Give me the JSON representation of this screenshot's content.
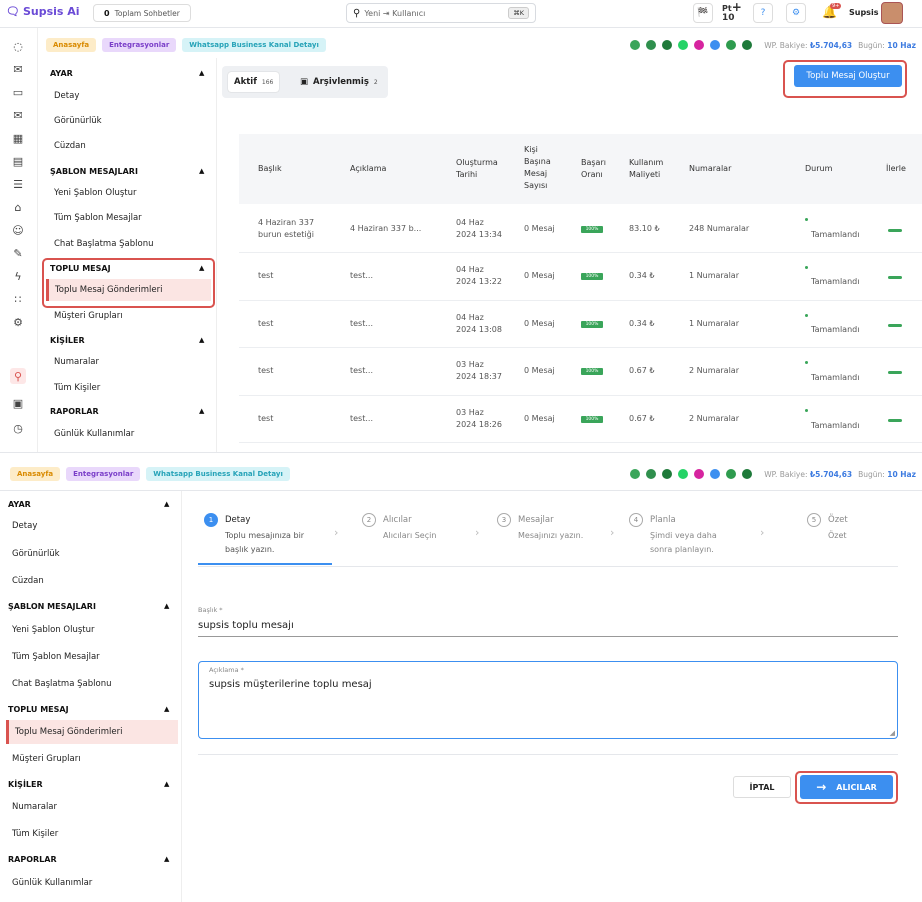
{
  "topbar": {
    "logo": "Supsis Ai",
    "chat_count": "0",
    "chat_count_label": "Toplam Sohbetler",
    "search_placeholder": "Yeni ⇥ Kullanıcı",
    "search_shortcut": "⌘K",
    "pt_label": "Pt",
    "pt_value": "10",
    "notification_badge": "9+",
    "username": "Supsis"
  },
  "breadcrumbs": [
    "Anasayfa",
    "Entegrasyonlar",
    "Whatsapp Business Kanal Detayı"
  ],
  "balance_label": "WP. Bakiye:",
  "balance_value": "₺5.704,63",
  "today_label": "Bugün:",
  "today_value": "10 Haz",
  "menu": {
    "ayar": "AYAR",
    "detay": "Detay",
    "gorunurluk": "Görünürlük",
    "cuzdan": "Cüzdan",
    "sablon": "ŞABLON MESAJLARI",
    "yeni_sablon": "Yeni Şablon Oluştur",
    "tum_sablon": "Tüm Şablon Mesajlar",
    "chat_baslatma": "Chat Başlatma Şablonu",
    "toplu": "TOPLU MESAJ",
    "toplu_gonderim": "Toplu Mesaj Gönderimleri",
    "musteri": "Müşteri Grupları",
    "kisiler": "KİŞİLER",
    "numaralar": "Numaralar",
    "tum_kisiler": "Tüm Kişiler",
    "raporlar": "RAPORLAR",
    "gunluk": "Günlük Kullanımlar"
  },
  "tabs": {
    "active_label": "Aktif",
    "active_count": "166",
    "archived_label": "Arşivlenmiş",
    "archived_count": "2"
  },
  "create_button": "Toplu Mesaj Oluştur",
  "table": {
    "headers": {
      "baslik": "Başlık",
      "aciklama": "Açıklama",
      "tarih_1": "Oluşturma",
      "tarih_2": "Tarihi",
      "kisi_1": "Kişi",
      "kisi_2": "Başına",
      "kisi_3": "Mesaj",
      "kisi_4": "Sayısı",
      "basari_1": "Başarı",
      "basari_2": "Oranı",
      "maliyet_1": "Kullanım",
      "maliyet_2": "Maliyeti",
      "numaralar": "Numaralar",
      "durum": "Durum",
      "ilerleme": "İlerle"
    },
    "rows": [
      {
        "title_1": "4 Haziran 337",
        "title_2": "burun estetiği",
        "desc": "4 Haziran 337 b...",
        "date_1": "04 Haz",
        "date_2": "2024 13:34",
        "msg": "0 Mesaj",
        "rate": "100%",
        "cost": "83.10 ₺",
        "numbers": "248 Numaralar",
        "status": "Tamamlandı"
      },
      {
        "title_1": "test",
        "title_2": "",
        "desc": "test...",
        "date_1": "04 Haz",
        "date_2": "2024 13:22",
        "msg": "0 Mesaj",
        "rate": "100%",
        "cost": "0.34 ₺",
        "numbers": "1 Numaralar",
        "status": "Tamamlandı"
      },
      {
        "title_1": "test",
        "title_2": "",
        "desc": "test...",
        "date_1": "04 Haz",
        "date_2": "2024 13:08",
        "msg": "0 Mesaj",
        "rate": "100%",
        "cost": "0.34 ₺",
        "numbers": "1 Numaralar",
        "status": "Tamamlandı"
      },
      {
        "title_1": "test",
        "title_2": "",
        "desc": "test...",
        "date_1": "03 Haz",
        "date_2": "2024 18:37",
        "msg": "0 Mesaj",
        "rate": "100%",
        "cost": "0.67 ₺",
        "numbers": "2 Numaralar",
        "status": "Tamamlandı"
      },
      {
        "title_1": "test",
        "title_2": "",
        "desc": "test...",
        "date_1": "03 Haz",
        "date_2": "2024 18:26",
        "msg": "0 Mesaj",
        "rate": "100%",
        "cost": "0.67 ₺",
        "numbers": "2 Numaralar",
        "status": "Tamamlandı"
      }
    ]
  },
  "wizard": {
    "steps": [
      {
        "num": "1",
        "title": "Detay",
        "sub_1": "Toplu mesajınıza bir",
        "sub_2": "başlık yazın."
      },
      {
        "num": "2",
        "title": "Alıcılar",
        "sub_1": "Alıcıları Seçin",
        "sub_2": ""
      },
      {
        "num": "3",
        "title": "Mesajlar",
        "sub_1": "Mesajınızı yazın.",
        "sub_2": ""
      },
      {
        "num": "4",
        "title": "Planla",
        "sub_1": "Şimdi veya daha",
        "sub_2": "sonra planlayın."
      },
      {
        "num": "5",
        "title": "Özet",
        "sub_1": "Özet",
        "sub_2": ""
      }
    ],
    "title_label": "Başlık *",
    "title_value": "supsis toplu mesajı",
    "desc_label": "Açıklama *",
    "desc_value": "supsis müşterilerine toplu mesaj",
    "cancel": "İPTAL",
    "next": "ALICILAR"
  },
  "colors": {
    "accent": "#3c8ff0",
    "highlight": "#d9534f",
    "success": "#3aa55a"
  }
}
